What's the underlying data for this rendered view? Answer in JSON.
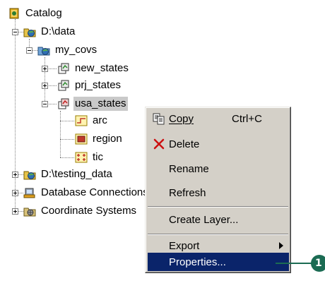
{
  "tree": {
    "root": {
      "label": "Catalog",
      "icon": "catalog-icon"
    },
    "items": [
      {
        "label": "D:\\data",
        "icon": "folder-connection-icon",
        "expander": "minus"
      },
      {
        "label": "my_covs",
        "icon": "coverage-workspace-icon",
        "expander": "minus"
      },
      {
        "label": "new_states",
        "icon": "coverage-icon",
        "expander": "plus"
      },
      {
        "label": "prj_states",
        "icon": "coverage-icon",
        "expander": "plus"
      },
      {
        "label": "usa_states",
        "icon": "coverage-icon",
        "expander": "minus",
        "selected": true
      },
      {
        "label": "arc",
        "icon": "arc-feature-class-icon"
      },
      {
        "label": "region",
        "icon": "region-feature-class-icon"
      },
      {
        "label": "tic",
        "icon": "tic-feature-class-icon"
      },
      {
        "label": "D:\\testing_data",
        "icon": "folder-connection-icon",
        "expander": "plus"
      },
      {
        "label": "Database Connections",
        "icon": "database-connections-icon",
        "expander": "plus"
      },
      {
        "label": "Coordinate Systems",
        "icon": "coordinate-systems-icon",
        "expander": "plus"
      }
    ]
  },
  "context_menu": {
    "items": [
      {
        "label": "Copy",
        "shortcut": "Ctrl+C",
        "icon": "copy-icon"
      },
      {
        "label": "Delete",
        "icon": "delete-icon"
      },
      {
        "label": "Rename"
      },
      {
        "label": "Refresh"
      },
      {
        "label": "Create Layer..."
      },
      {
        "label": "Export",
        "has_submenu": true
      },
      {
        "label": "Properties...",
        "highlighted": true
      }
    ]
  },
  "callout": {
    "number": "1"
  },
  "colors": {
    "menu_bg": "#d4d0c8",
    "highlight": "#0a246a",
    "callout": "#1b6b53",
    "selection": "#c9c9c9"
  }
}
